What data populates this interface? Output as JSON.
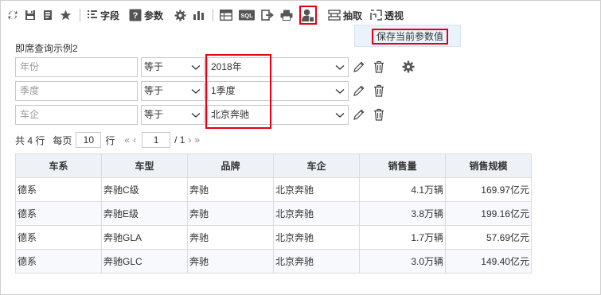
{
  "toolbar": {
    "fields_label": "字段",
    "params_label": "参数",
    "extract_label": "抽取",
    "pivot_label": "透视",
    "sql_label": "SQL"
  },
  "save_menu": {
    "item": "保存当前参数值"
  },
  "query": {
    "title": "即席查询示例2",
    "rows": [
      {
        "field_placeholder": "年份",
        "operator": "等于",
        "value": "2018年"
      },
      {
        "field_placeholder": "季度",
        "operator": "等于",
        "value": "1季度"
      },
      {
        "field_placeholder": "车企",
        "operator": "等于",
        "value": "北京奔驰"
      }
    ]
  },
  "pager": {
    "total": "共 4 行",
    "per_page_label": "每页",
    "per_page": "10",
    "rows_unit": "行",
    "current_page": "1",
    "total_pages": "/ 1"
  },
  "table": {
    "headers": [
      "车系",
      "车型",
      "品牌",
      "车企",
      "销售量",
      "销售规模"
    ],
    "rows": [
      [
        "德系",
        "奔驰C级",
        "奔驰",
        "北京奔驰",
        "4.1万辆",
        "169.97亿元"
      ],
      [
        "德系",
        "奔驰E级",
        "奔驰",
        "北京奔驰",
        "3.8万辆",
        "199.16亿元"
      ],
      [
        "德系",
        "奔驰GLA",
        "奔驰",
        "北京奔驰",
        "1.7万辆",
        "57.69亿元"
      ],
      [
        "德系",
        "奔驰GLC",
        "奔驰",
        "北京奔驰",
        "3.0万辆",
        "149.40亿元"
      ]
    ]
  },
  "colors": {
    "highlight": "#e60012",
    "header_bg": "#eef1f5",
    "menu_bg": "#eaf2fb"
  }
}
